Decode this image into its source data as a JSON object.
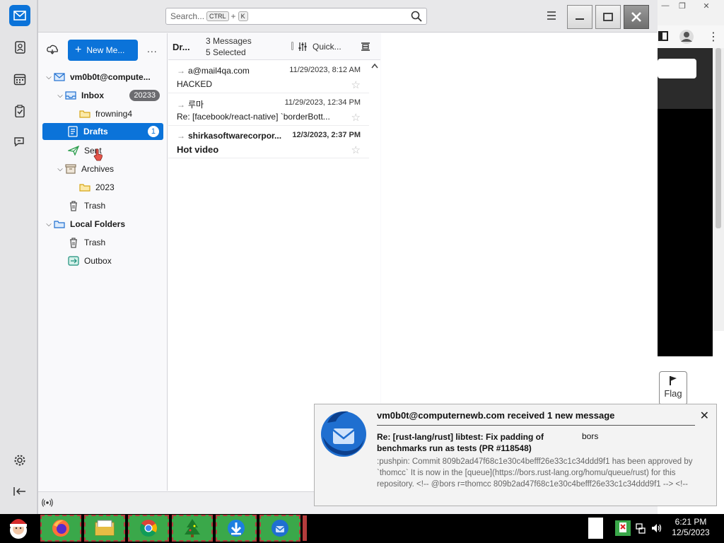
{
  "app": {
    "search_placeholder": "Search...",
    "search_key1": "CTRL",
    "search_plus": "+",
    "search_key2": "K"
  },
  "folder_pane": {
    "new_message": "New Me...",
    "more": "...",
    "account": "vm0b0t@compute...",
    "folders": {
      "inbox": {
        "label": "Inbox",
        "count": "20233"
      },
      "frowning4": {
        "label": "frowning4"
      },
      "drafts": {
        "label": "Drafts",
        "count": "1"
      },
      "sent": {
        "label": "Sent"
      },
      "archives": {
        "label": "Archives"
      },
      "y2023": {
        "label": "2023"
      },
      "trash": {
        "label": "Trash"
      },
      "local_folders": {
        "label": "Local Folders"
      },
      "local_trash": {
        "label": "Trash"
      },
      "outbox": {
        "label": "Outbox"
      }
    }
  },
  "message_list": {
    "folder_title": "Dr...",
    "count_text": "3 Messages",
    "selected_text": "5 Selected",
    "quick_filter": "Quick...",
    "messages": [
      {
        "from": "a@mail4qa.com",
        "date": "11/29/2023, 8:12 AM",
        "subject": "HACKED",
        "bold": false
      },
      {
        "from": "루마",
        "date": "11/29/2023, 12:34 PM",
        "subject": "Re: [facebook/react-native] `borderBott...",
        "bold": false
      },
      {
        "from": "shirkasoftwarecorpor...",
        "date": "12/3/2023, 2:37 PM",
        "subject": "Hot video",
        "bold": true
      }
    ]
  },
  "background_browser": {
    "flag_label": "Flag"
  },
  "notification": {
    "title": "vm0b0t@computernewb.com received 1 new message",
    "subject": "Re: [rust-lang/rust] libtest: Fix padding of benchmarks run as tests (PR #118548)",
    "sender": "bors",
    "body": ":pushpin: Commit 809b2ad47f68c1e30c4befff26e33c1c34ddd9f1 has been approved by `thomcc` It is now in the [queue](https://bors.rust-lang.org/homu/queue/rust) for this repository. <!-- @bors r=thomcc 809b2ad47f68c1e30c4befff26e33c1c34ddd9f1 --> <!--"
  },
  "taskbar": {
    "time": "6:21 PM",
    "date": "12/5/2023"
  },
  "colors": {
    "accent": "#0b73d9",
    "taskbar_button": "#3aa84a"
  }
}
